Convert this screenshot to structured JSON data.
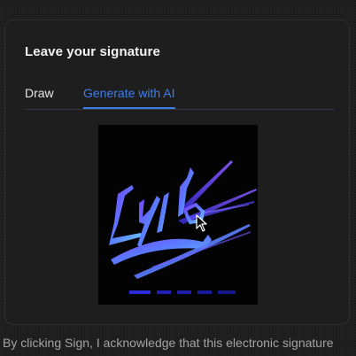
{
  "card": {
    "title": "Leave your signature"
  },
  "tabs": [
    {
      "label": "Draw",
      "active": false
    },
    {
      "label": "Generate with AI",
      "active": true
    }
  ],
  "signature": {
    "progress_segments": 5
  },
  "footer": {
    "text": "By clicking Sign, I acknowledge that this electronic signature"
  },
  "colors": {
    "accent": "#3f7de6",
    "background": "#1c1c1c",
    "card_border": "#2f2f2f"
  }
}
